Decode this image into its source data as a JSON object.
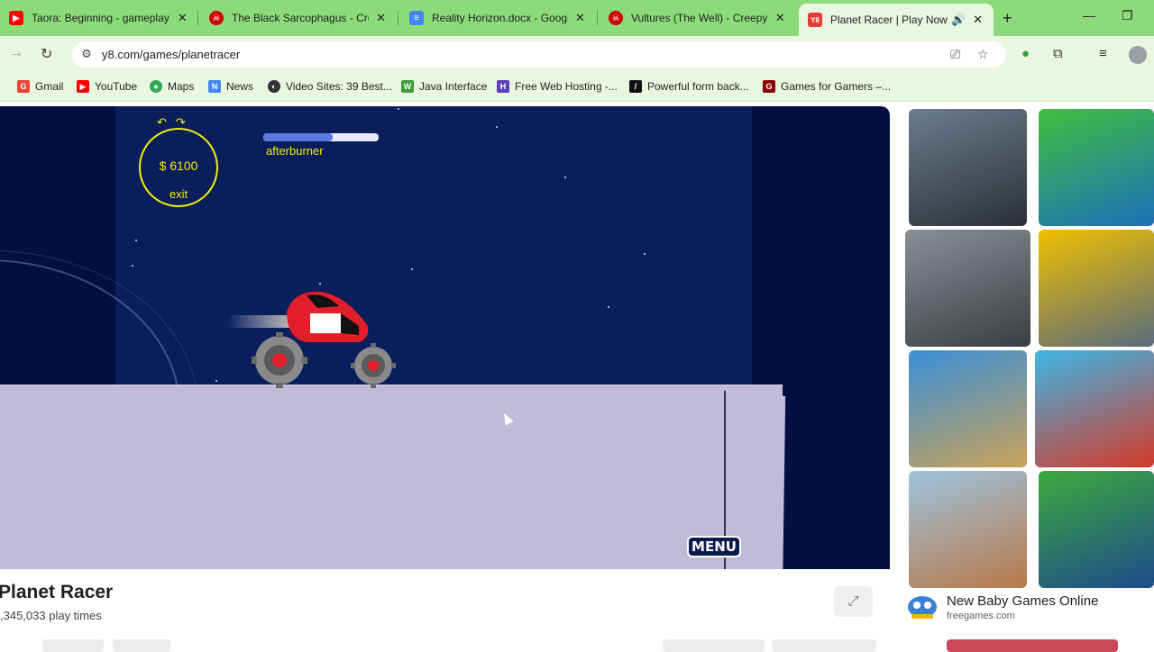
{
  "tabs": [
    {
      "title": "Taora: Beginning - gameplay (",
      "favicon": "youtube-icon",
      "color": "#ff0000"
    },
    {
      "title": "The Black Sarcophagus - Cree",
      "favicon": "skull-icon",
      "color": "#cc0000"
    },
    {
      "title": "Reality Horizon.docx - Google",
      "favicon": "docs-icon",
      "color": "#4285f4"
    },
    {
      "title": "Vultures (The Well) - Creepyp",
      "favicon": "skull-icon",
      "color": "#cc0000"
    },
    {
      "title": "Planet Racer | Play Now O",
      "favicon": "y8-icon",
      "color": "#e53935",
      "active": true
    }
  ],
  "address_bar": {
    "url": "y8.com/games/planetracer"
  },
  "bookmarks": [
    {
      "label": "Gmail",
      "icon": "gmail-icon",
      "color": "#ea4335",
      "glyph": "G"
    },
    {
      "label": "YouTube",
      "icon": "youtube-icon",
      "color": "#ff0000",
      "glyph": "▶"
    },
    {
      "label": "Maps",
      "icon": "maps-icon",
      "color": "#34a853",
      "glyph": "●"
    },
    {
      "label": "News",
      "icon": "news-icon",
      "color": "#4285f4",
      "glyph": "N"
    },
    {
      "label": "Video Sites: 39 Best...",
      "icon": "globe-icon",
      "color": "#333333",
      "glyph": "◐"
    },
    {
      "label": "Java Interface",
      "icon": "w-icon",
      "color": "#3c9c3c",
      "glyph": "W"
    },
    {
      "label": "Free Web Hosting -...",
      "icon": "hosting-icon",
      "color": "#5b3fb8",
      "glyph": "H"
    },
    {
      "label": "Powerful form back...",
      "icon": "form-icon",
      "color": "#111111",
      "glyph": "/"
    },
    {
      "label": "Games for Gamers –...",
      "icon": "games-icon",
      "color": "#8b0000",
      "glyph": "G"
    }
  ],
  "game": {
    "money": "$ 6100",
    "exit_label": "exit",
    "afterburner_label": "afterburner",
    "afterburner_level": 0.6,
    "menu_label": "MENU"
  },
  "game_info": {
    "title": "Planet Racer",
    "play_times": ",345,033 play times"
  },
  "sidebar": {
    "thumbnails": [
      {
        "name": "bus-driving-thumbnail",
        "c1": "#6b7d8e",
        "c2": "#2b2f36"
      },
      {
        "name": "green-bus-thumbnail",
        "c1": "#3fbf3f",
        "c2": "#1d6fb8"
      },
      {
        "name": "silver-sports-car-thumbnail",
        "c1": "#8a8f96",
        "c2": "#3a3d42"
      },
      {
        "name": "robot-car-thumbnail",
        "c1": "#f0c000",
        "c2": "#5a6b7d"
      },
      {
        "name": "monster-truck-thumbnail",
        "c1": "#3a8fd8",
        "c2": "#c9a25a"
      },
      {
        "name": "motocross-thumbnail",
        "c1": "#3db6e6",
        "c2": "#d33a2a"
      },
      {
        "name": "suv-racing-thumbnail",
        "c1": "#9ec3dd",
        "c2": "#b8794a"
      },
      {
        "name": "soccer-thumbnail",
        "c1": "#3ea83e",
        "c2": "#1e4b8a"
      }
    ],
    "ad": {
      "title": "New Baby Games Online",
      "source": "freegames.com"
    }
  }
}
